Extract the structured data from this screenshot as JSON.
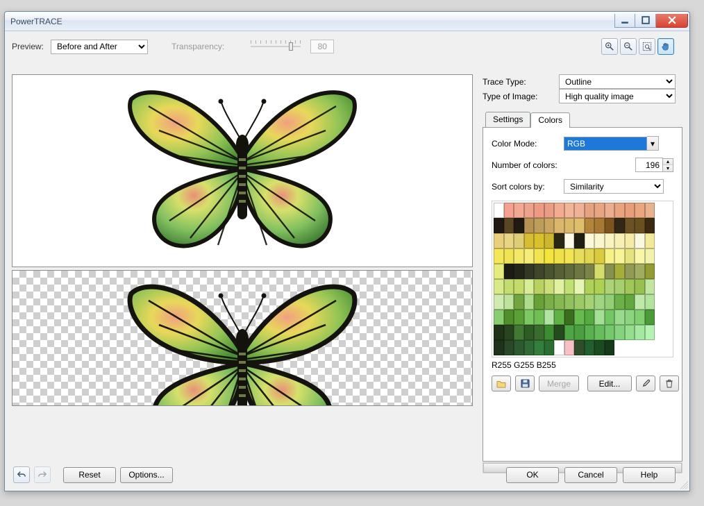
{
  "window": {
    "title": "PowerTRACE"
  },
  "toprow": {
    "preview_label": "Preview:",
    "preview_mode": "Before and After",
    "transparency_label": "Transparency:",
    "transparency_value": "80"
  },
  "icons": {
    "zoom_in": "zoom-in",
    "zoom_out": "zoom-out",
    "fit": "zoom-fit",
    "hand": "pan-hand"
  },
  "right": {
    "trace_type_label": "Trace Type:",
    "trace_type": "Outline",
    "image_type_label": "Type of Image:",
    "image_type": "High quality image"
  },
  "tabs": {
    "settings": "Settings",
    "colors": "Colors",
    "active": "colors"
  },
  "colors_tab": {
    "color_mode_label": "Color Mode:",
    "color_mode": "RGB",
    "num_colors_label": "Number of colors:",
    "num_colors": "196",
    "sort_by_label": "Sort colors by:",
    "sort_by": "Similarity",
    "readout": "R255 G255 B255",
    "open": "",
    "save": "",
    "merge": "Merge",
    "edit": "Edit...",
    "pick": "",
    "delete": ""
  },
  "footer": {
    "reset": "Reset",
    "options": "Options...",
    "ok": "OK",
    "cancel": "Cancel",
    "help": "Help"
  },
  "swatches": [
    "#ffffff",
    "#f6a08f",
    "#f3a893",
    "#eea28e",
    "#ee9a85",
    "#e99d84",
    "#f1ac92",
    "#f2b598",
    "#efb296",
    "#e6a381",
    "#e7a583",
    "#ecae91",
    "#e9a47f",
    "#e89e78",
    "#eaa77f",
    "#e9b18c",
    "#201911",
    "#5a4524",
    "#201a12",
    "#b79253",
    "#be9c5c",
    "#caa561",
    "#dcb66c",
    "#dcb969",
    "#e0be6e",
    "#b3853a",
    "#a87932",
    "#7e541e",
    "#322615",
    "#6c5127",
    "#6a4f1f",
    "#3b2a11",
    "#e9cf7a",
    "#e8d483",
    "#decd77",
    "#d7bd32",
    "#d9c12d",
    "#ccb62e",
    "#2b2514",
    "#fdf9e9",
    "#201e14",
    "#fcf8da",
    "#faf6ce",
    "#f8f3c0",
    "#f7efb4",
    "#f5eba6",
    "#faf8e1",
    "#f3e999",
    "#f4e65a",
    "#f0e356",
    "#f3e868",
    "#f6ed78",
    "#f1e453",
    "#f4e43e",
    "#efe148",
    "#f2e452",
    "#e6de5b",
    "#e2d54f",
    "#dacb3e",
    "#f6f286",
    "#f8f498",
    "#e5e37e",
    "#f9f6a8",
    "#f2f2ac",
    "#e6eb7f",
    "#1b1d13",
    "#222518",
    "#333824",
    "#3e452a",
    "#4a5330",
    "#565f36",
    "#616a3c",
    "#6e7742",
    "#7a8348",
    "#d6dc6c",
    "#869151",
    "#a6ae3a",
    "#929b55",
    "#a0ac5e",
    "#939b35",
    "#d8e988",
    "#c2dc70",
    "#c4da69",
    "#d8ed9a",
    "#b7d261",
    "#ccde77",
    "#e1f0a1",
    "#c0e072",
    "#e6f5b4",
    "#b0d159",
    "#aed053",
    "#aed278",
    "#a6d06f",
    "#a0c758",
    "#98c050",
    "#c1e69f",
    "#d0ebb0",
    "#bde39c",
    "#72a540",
    "#afdb8d",
    "#6aa038",
    "#7bb048",
    "#86b953",
    "#90c15d",
    "#9bca67",
    "#a5d272",
    "#9fd481",
    "#94cf77",
    "#6bb147",
    "#62a83e",
    "#bfe9ab",
    "#b3e49e",
    "#88cd6e",
    "#518f2c",
    "#5aa036",
    "#7cc963",
    "#70bf55",
    "#b1e4a2",
    "#5fb344",
    "#3a6e1e",
    "#66bb4f",
    "#55aa42",
    "#a5de97",
    "#73c762",
    "#99da8c",
    "#8cd47e",
    "#80cf71",
    "#4b9b38",
    "#1e3216",
    "#294520",
    "#417832",
    "#2f5b25",
    "#396c2d",
    "#3a8e31",
    "#254a1d",
    "#4ea545",
    "#4b9f41",
    "#59b04e",
    "#67bc5d",
    "#76c86d",
    "#85d37e",
    "#94de8e",
    "#a4e99f",
    "#b3f4b0",
    "#1e331c",
    "#284828",
    "#2c5a2f",
    "#306b36",
    "#337d3d",
    "#2c6e30",
    "#ffffff",
    "#f7c0c6",
    "#2e4d28",
    "#215f2e",
    "#1b4c20",
    "#16391a",
    "",
    "",
    "",
    ""
  ]
}
